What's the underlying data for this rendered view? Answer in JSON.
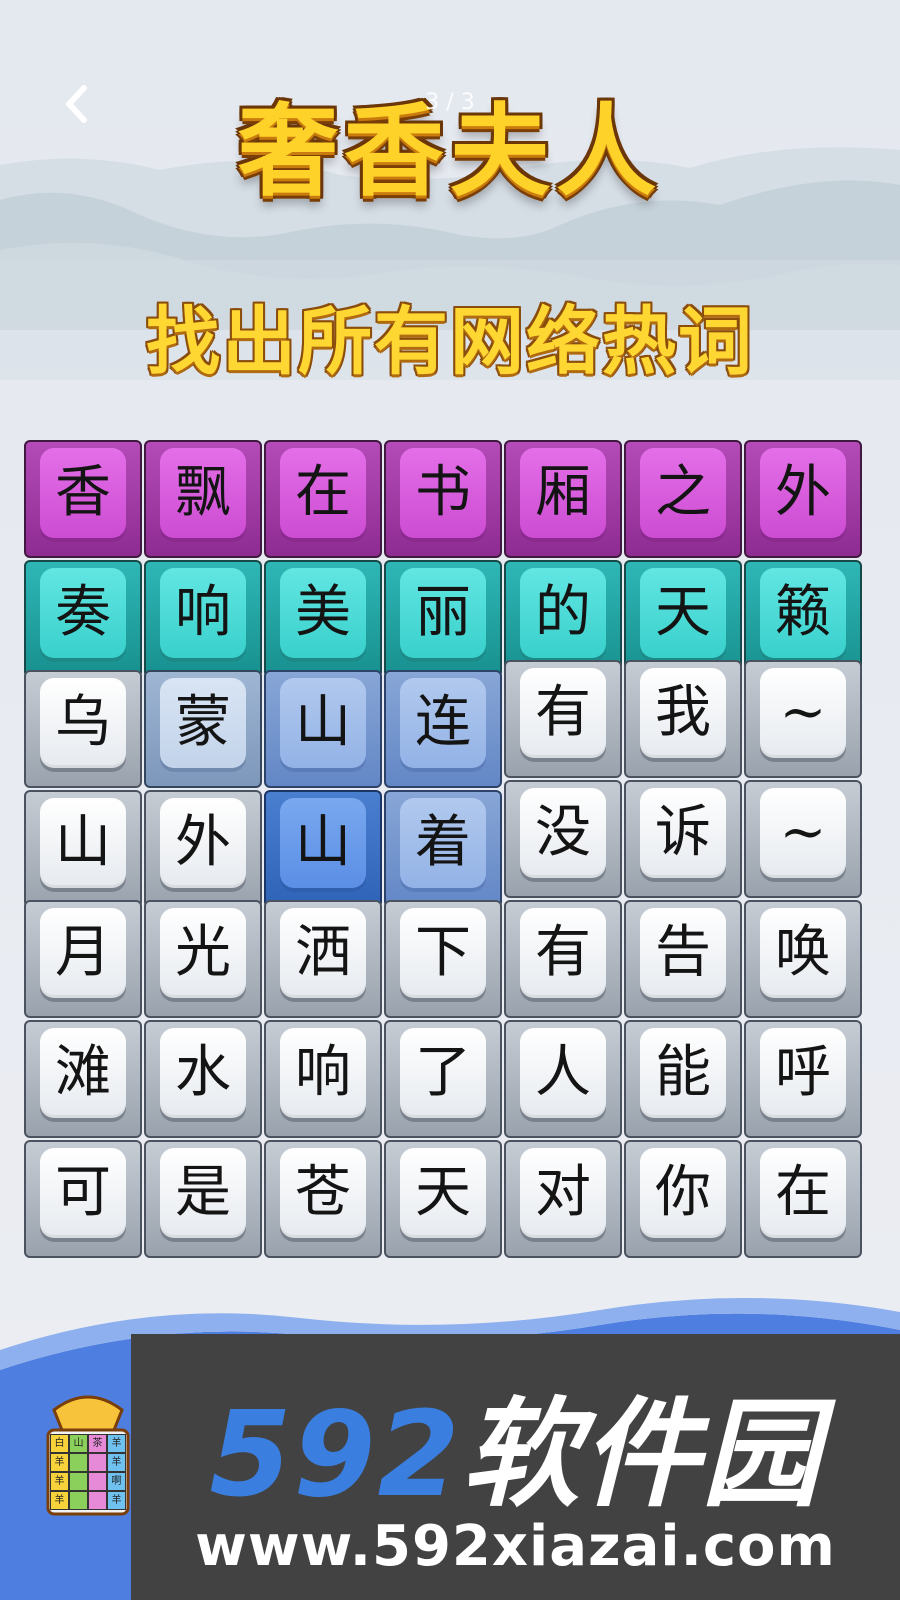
{
  "header": {
    "back_icon": "chevron-left-icon",
    "progress": "3 / 3",
    "title": "奢香夫人"
  },
  "instruction": "找出所有网络热词",
  "board": {
    "rows": [
      [
        {
          "char": "香",
          "state": "purple"
        },
        {
          "char": "飘",
          "state": "purple"
        },
        {
          "char": "在",
          "state": "purple"
        },
        {
          "char": "书",
          "state": "purple"
        },
        {
          "char": "厢",
          "state": "purple"
        },
        {
          "char": "之",
          "state": "purple"
        },
        {
          "char": "外",
          "state": "purple"
        }
      ],
      [
        {
          "char": "奏",
          "state": "teal"
        },
        {
          "char": "响",
          "state": "teal"
        },
        {
          "char": "美",
          "state": "teal"
        },
        {
          "char": "丽",
          "state": "teal"
        },
        {
          "char": "的",
          "state": "teal"
        },
        {
          "char": "天",
          "state": "teal"
        },
        {
          "char": "籁",
          "state": "teal"
        }
      ],
      [
        {
          "char": "乌",
          "state": "plain"
        },
        {
          "char": "蒙",
          "state": "blue1"
        },
        {
          "char": "山",
          "state": "blue2"
        },
        {
          "char": "连",
          "state": "blue2"
        },
        {
          "char": "有",
          "state": "plain"
        },
        {
          "char": "我",
          "state": "plain"
        },
        {
          "char": "~",
          "state": "plain"
        }
      ],
      [
        {
          "char": "山",
          "state": "plain"
        },
        {
          "char": "外",
          "state": "plain"
        },
        {
          "char": "山",
          "state": "blue3"
        },
        {
          "char": "着",
          "state": "blue2"
        },
        {
          "char": "没",
          "state": "plain"
        },
        {
          "char": "诉",
          "state": "plain"
        },
        {
          "char": "~",
          "state": "plain"
        }
      ],
      [
        {
          "char": "月",
          "state": "plain"
        },
        {
          "char": "光",
          "state": "plain"
        },
        {
          "char": "洒",
          "state": "plain"
        },
        {
          "char": "下",
          "state": "plain"
        },
        {
          "char": "有",
          "state": "plain"
        },
        {
          "char": "告",
          "state": "plain"
        },
        {
          "char": "唤",
          "state": "plain"
        }
      ],
      [
        {
          "char": "滩",
          "state": "plain"
        },
        {
          "char": "水",
          "state": "plain"
        },
        {
          "char": "响",
          "state": "plain"
        },
        {
          "char": "了",
          "state": "plain"
        },
        {
          "char": "人",
          "state": "plain"
        },
        {
          "char": "能",
          "state": "plain"
        },
        {
          "char": "呼",
          "state": "plain"
        }
      ],
      [
        {
          "char": "可",
          "state": "plain"
        },
        {
          "char": "是",
          "state": "plain"
        },
        {
          "char": "苍",
          "state": "plain"
        },
        {
          "char": "天",
          "state": "plain"
        },
        {
          "char": "对",
          "state": "plain"
        },
        {
          "char": "你",
          "state": "plain"
        },
        {
          "char": "在",
          "state": "plain"
        }
      ]
    ]
  },
  "mascot": {
    "grid_chars": [
      "白",
      "山",
      "茶",
      "羊",
      "羊",
      "",
      "",
      "羊",
      "羊",
      "",
      "",
      "啊",
      "羊",
      "",
      "",
      "羊"
    ]
  },
  "watermark": {
    "logo_number": "592",
    "logo_text": "软件园",
    "url": "www.592xiazai.com"
  }
}
